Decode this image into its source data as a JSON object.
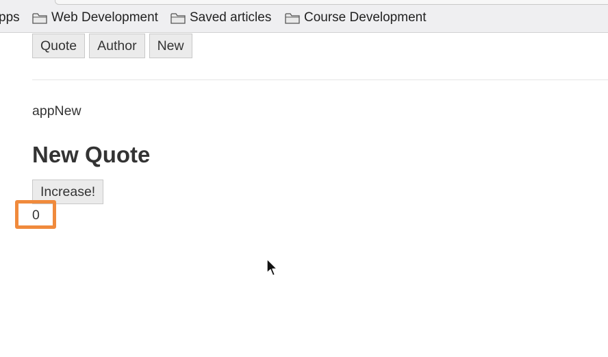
{
  "bookmarks": {
    "items": [
      {
        "label": "pps",
        "icon": "apps-grid-icon"
      },
      {
        "label": "Web Development",
        "icon": "folder-icon"
      },
      {
        "label": "Saved articles",
        "icon": "folder-icon"
      },
      {
        "label": "Course Development",
        "icon": "folder-icon"
      }
    ]
  },
  "nav": {
    "buttons": [
      {
        "label": "Quote"
      },
      {
        "label": "Author"
      },
      {
        "label": "New"
      }
    ]
  },
  "main": {
    "app_label": "appNew",
    "heading": "New Quote",
    "increase_label": "Increase!",
    "counter_value": "0"
  },
  "colors": {
    "highlight": "#f08a3c",
    "button_bg": "#ebebeb",
    "text": "#333333"
  }
}
